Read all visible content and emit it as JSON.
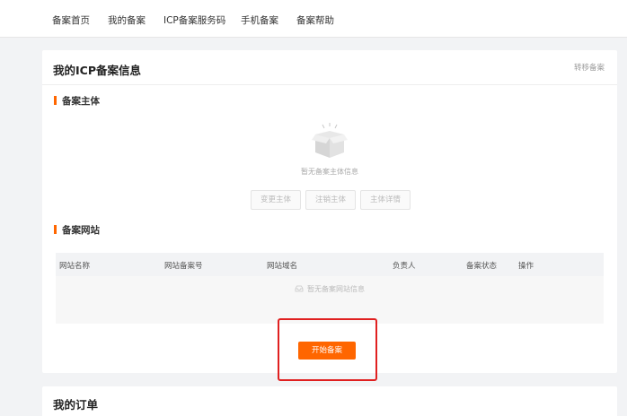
{
  "nav": {
    "items": [
      "备案首页",
      "我的备案",
      "ICP备案服务码",
      "手机备案",
      "备案帮助"
    ]
  },
  "main": {
    "title": "我的ICP备案信息",
    "link": "转移备案",
    "subject": {
      "title": "备案主体",
      "empty_text": "暂无备案主体信息",
      "buttons": [
        "变更主体",
        "注销主体",
        "主体详情"
      ]
    },
    "website": {
      "title": "备案网站",
      "columns": [
        "网站名称",
        "网站备案号",
        "网站域名",
        "负责人",
        "备案状态",
        "操作"
      ],
      "empty_text": "暂无备案网站信息"
    },
    "start_button": "开始备案"
  },
  "orders": {
    "title": "我的订单"
  },
  "colors": {
    "accent": "#ff6600",
    "highlight": "#e02020"
  },
  "icons": {
    "empty_subject": "empty-box-icon",
    "empty_table": "empty-inbox-icon"
  }
}
